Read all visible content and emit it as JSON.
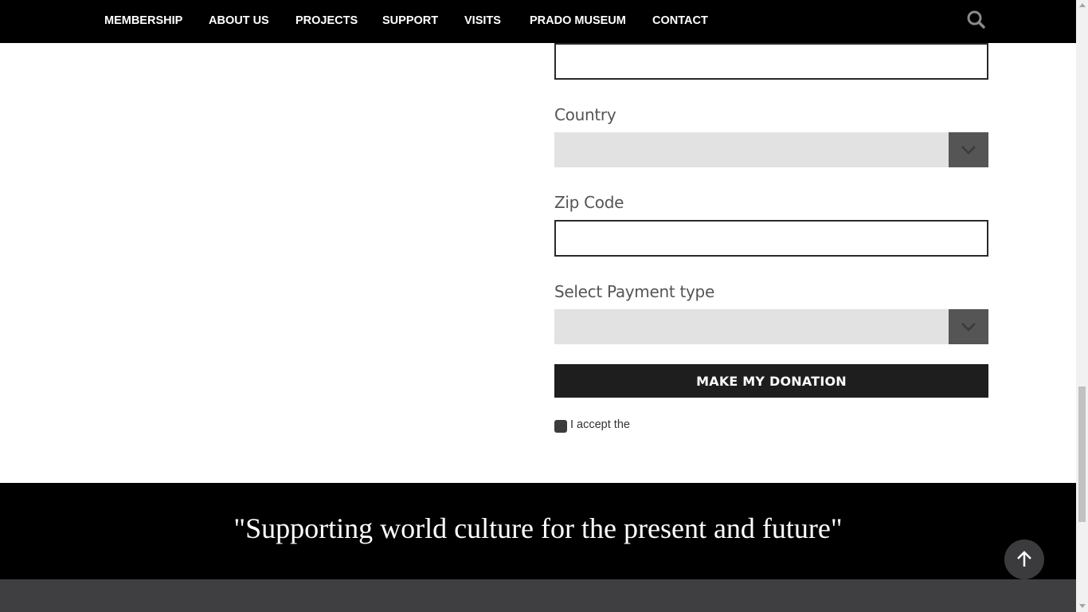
{
  "nav": {
    "items": [
      {
        "label": "MEMBERSHIP"
      },
      {
        "label": "ABOUT US"
      },
      {
        "label": "PROJECTS"
      },
      {
        "label": "SUPPORT"
      },
      {
        "label": "VISITS"
      },
      {
        "label": "PRADO MUSEUM"
      },
      {
        "label": "CONTACT"
      }
    ],
    "search_icon": "search-icon"
  },
  "form": {
    "top_field": {
      "value": ""
    },
    "country": {
      "label": "Country",
      "value": ""
    },
    "zip": {
      "label": "Zip Code",
      "value": ""
    },
    "payment": {
      "label": "Select Payment type",
      "value": ""
    },
    "submit_label": "MAKE MY DONATION",
    "accept_label": "I accept the"
  },
  "quote": "\"Supporting world culture for the present and future\"",
  "colors": {
    "nav_bg": "#000000",
    "button_bg": "#1e1e1e",
    "select_bg": "#e2e2e2",
    "footer_bg": "#3f3f41"
  }
}
